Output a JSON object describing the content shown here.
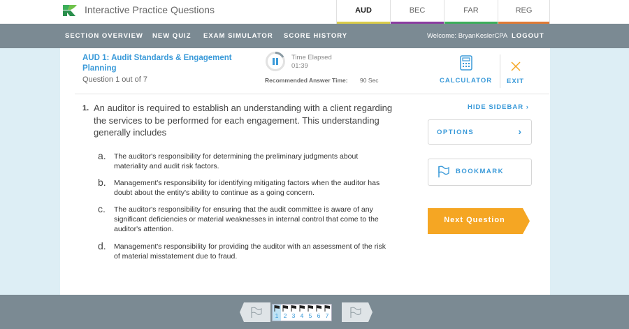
{
  "header": {
    "app_title": "Interactive Practice Questions",
    "tabs": [
      {
        "label": "AUD",
        "color": "#d9cc4a",
        "active": true
      },
      {
        "label": "BEC",
        "color": "#8a3ca0",
        "active": false
      },
      {
        "label": "FAR",
        "color": "#3cae5a",
        "active": false
      },
      {
        "label": "REG",
        "color": "#e07a35",
        "active": false
      }
    ]
  },
  "nav": {
    "links": [
      "SECTION OVERVIEW",
      "NEW QUIZ",
      "EXAM SIMULATOR",
      "SCORE HISTORY"
    ],
    "welcome": "Welcome: BryanKeslerCPA",
    "logout": "LOGOUT"
  },
  "question_header": {
    "title": "AUD 1: Audit Standards & Engagement Planning",
    "count": "Question 1 out of 7",
    "time_label": "Time Elapsed",
    "time_value": "01:39",
    "recommended_label": "Recommended Answer Time:",
    "recommended_value": "90 Sec",
    "calculator": "CALCULATOR",
    "exit": "EXIT"
  },
  "question": {
    "number": "1.",
    "text": "An auditor is required to establish an understanding with a client regarding the services to be performed for each engagement. This understanding generally includes",
    "choices": [
      {
        "letter": "a.",
        "text": "The auditor's responsibility for determining the preliminary judgments about materiality and audit risk factors."
      },
      {
        "letter": "b.",
        "text": "Management's responsibility for identifying mitigating factors when the auditor has doubt about the entity's ability to continue as a going concern."
      },
      {
        "letter": "c.",
        "text": "The auditor's responsibility for ensuring that the audit committee is aware of any significant deficiencies or material weaknesses in internal control that come to the auditor's attention."
      },
      {
        "letter": "d.",
        "text": "Management's responsibility for providing the auditor with an assessment of the risk of material misstatement due to fraud."
      }
    ]
  },
  "sidebar": {
    "hide": "HIDE SIDEBAR ›",
    "options": "OPTIONS",
    "bookmark": "BOOKMARK",
    "next": "Next Question"
  },
  "pager": {
    "pages": [
      "1",
      "2",
      "3",
      "4",
      "5",
      "6",
      "7"
    ],
    "current": "1"
  },
  "colors": {
    "accent": "#3a9ad9",
    "nav_bg": "#7b8a93",
    "next_button": "#f5a623"
  }
}
